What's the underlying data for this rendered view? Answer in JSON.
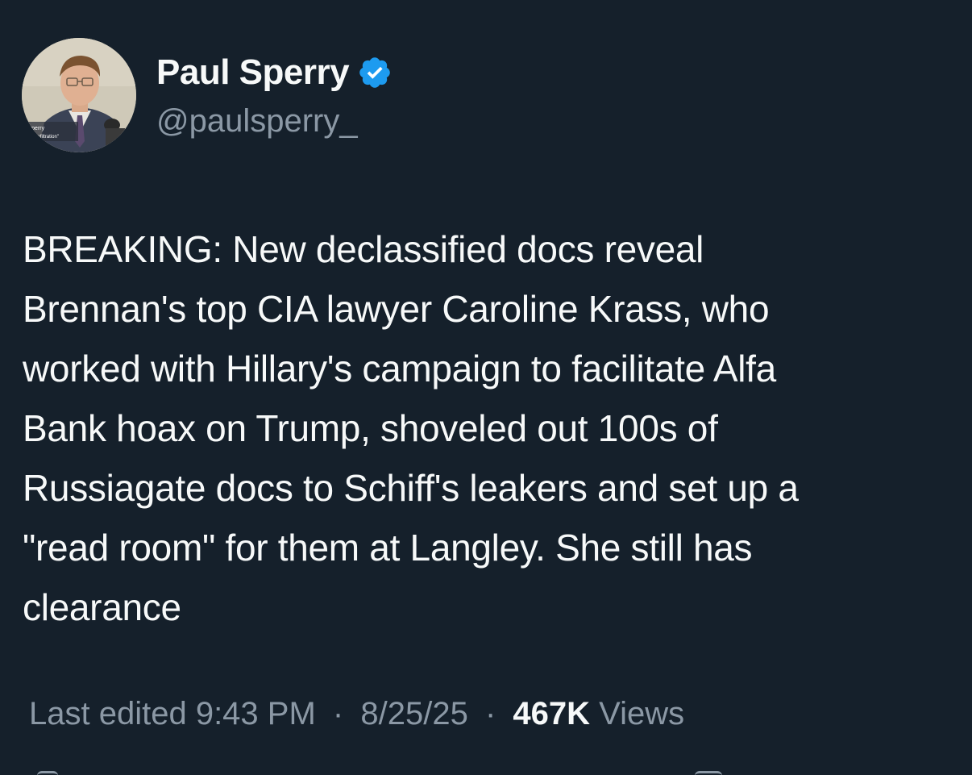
{
  "author": {
    "display_name": "Paul Sperry",
    "handle": "@paulsperry_",
    "verified": true,
    "verified_color": "#1d9bf0",
    "avatar_caption_line1": "l Sperry",
    "avatar_caption_line2": "hor, \"Infiltration\""
  },
  "tweet": {
    "text": "BREAKING: New declassified docs reveal\nBrennan's top CIA lawyer Caroline Krass, who\nworked with Hillary's campaign to facilitate Alfa\nBank hoax on Trump, shoveled out 100s of\nRussiagate docs to Schiff's leakers and set up a\n\"read room\" for them at Langley. She still has\nclearance"
  },
  "meta": {
    "edited_label": "Last edited 9:43 PM",
    "date": "8/25/25",
    "separator": "·",
    "views_count": "467K",
    "views_label": "Views"
  },
  "colors": {
    "background": "#15202b",
    "primary_text": "#f7f9f9",
    "secondary_text": "#8b98a5",
    "accent": "#1d9bf0"
  },
  "icons": {
    "verified": "verified-badge-icon"
  }
}
